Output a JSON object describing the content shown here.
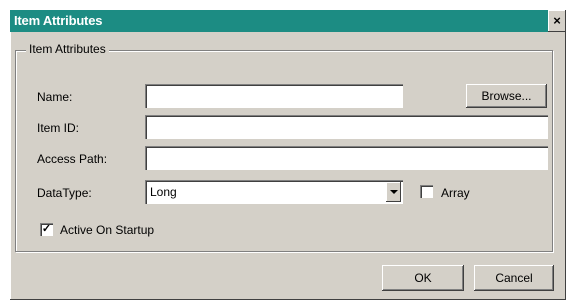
{
  "window": {
    "title": "Item Attributes",
    "close_glyph": "×"
  },
  "group": {
    "label": "Item Attributes"
  },
  "fields": {
    "name_label": "Name:",
    "name_value": "",
    "item_id_label": "Item ID:",
    "item_id_value": "",
    "access_path_label": "Access Path:",
    "access_path_value": "",
    "datatype_label": "DataType:",
    "datatype_value": "Long"
  },
  "checkboxes": {
    "array_label": "Array",
    "array_checked": false,
    "active_on_startup_label": "Active On Startup",
    "active_on_startup_checked": true,
    "check_glyph": "✓"
  },
  "buttons": {
    "browse": "Browse...",
    "ok": "OK",
    "cancel": "Cancel"
  },
  "colors": {
    "titlebar": "#1c8c83",
    "face": "#d4d0c8"
  }
}
